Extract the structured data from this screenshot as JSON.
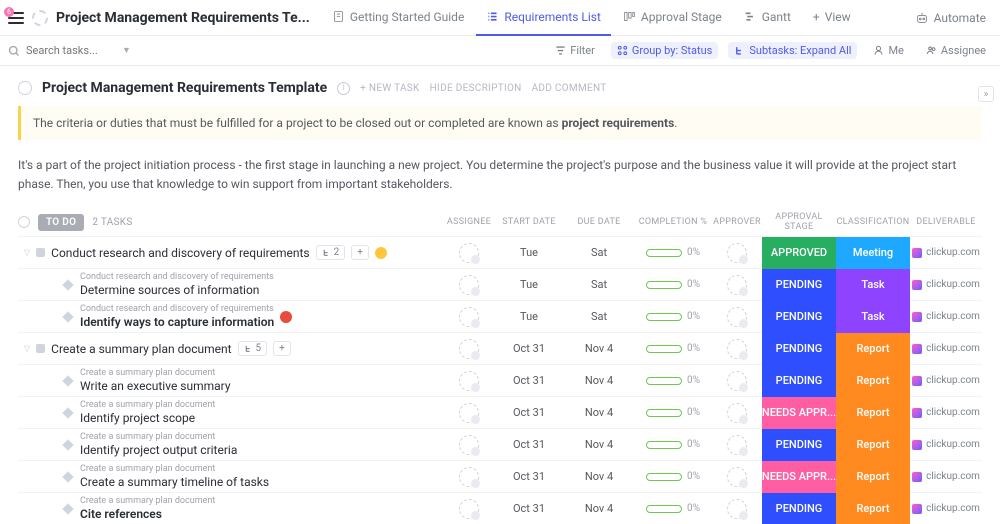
{
  "header": {
    "notif_count": "6",
    "title": "Project Management Requirements Te...",
    "tabs": [
      {
        "label": "Getting Started Guide"
      },
      {
        "label": "Requirements List"
      },
      {
        "label": "Approval Stage"
      },
      {
        "label": "Gantt"
      },
      {
        "label": "View"
      }
    ],
    "automate": "Automate"
  },
  "toolbar": {
    "search_placeholder": "Search tasks...",
    "filter": "Filter",
    "group": "Group by: Status",
    "subtasks": "Subtasks: Expand All",
    "me": "Me",
    "assignee": "Assignee"
  },
  "page": {
    "title": "Project Management Requirements Template",
    "new_task": "+ NEW TASK",
    "hide_desc": "HIDE DESCRIPTION",
    "add_comment": "ADD COMMENT",
    "banner_pre": "The criteria or duties that must be fulfilled for a project to be closed out or completed are known as ",
    "banner_bold": "project requirements",
    "desc": "It's a part of the project initiation process - the first stage in launching a new project. You determine the project's purpose and the business value it will provide at the project start phase. Then, you use that knowledge to win support from important stakeholders."
  },
  "group": {
    "status": "TO DO",
    "count": "2 TASKS"
  },
  "columns": {
    "assignee": "ASSIGNEE",
    "start": "START DATE",
    "due": "DUE DATE",
    "comp": "COMPLETION %",
    "approver": "APPROVER",
    "stage": "APPROVAL STAGE",
    "class": "CLASSIFICATION",
    "deliv": "DELIVERABLE"
  },
  "colors": {
    "approved": "#27ae60",
    "pending": "#2f4fff",
    "needs": "#ff5fa2",
    "meeting": "#1fa8ff",
    "task": "#8e44ff",
    "report": "#ff8a1f"
  },
  "deliv": "clickup.com",
  "tasks": [
    {
      "type": "parent",
      "name": "Conduct research and discovery of requirements",
      "sub_count": "2",
      "flag": "y",
      "start": "Tue",
      "due": "Sat",
      "pct": "0%",
      "stage": "APPROVED",
      "stage_c": "approved",
      "class": "Meeting",
      "class_c": "meeting"
    },
    {
      "type": "sub",
      "crumb": "Conduct research and discovery of requirements",
      "name": "Determine sources of information",
      "start": "Tue",
      "due": "Sat",
      "pct": "0%",
      "stage": "PENDING",
      "stage_c": "pending",
      "class": "Task",
      "class_c": "task"
    },
    {
      "type": "sub",
      "crumb": "Conduct research and discovery of requirements",
      "name": "Identify ways to capture information",
      "flag": "r",
      "start": "Tue",
      "due": "Sat",
      "pct": "0%",
      "stage": "PENDING",
      "stage_c": "pending",
      "class": "Task",
      "class_c": "task",
      "bold": true
    },
    {
      "type": "parent",
      "name": "Create a summary plan document",
      "sub_count": "5",
      "start": "Oct 31",
      "due": "Nov 4",
      "pct": "0%",
      "stage": "PENDING",
      "stage_c": "pending",
      "class": "Report",
      "class_c": "report"
    },
    {
      "type": "sub",
      "crumb": "Create a summary plan document",
      "name": "Write an executive summary",
      "start": "Oct 31",
      "due": "Nov 4",
      "pct": "0%",
      "stage": "PENDING",
      "stage_c": "pending",
      "class": "Report",
      "class_c": "report"
    },
    {
      "type": "sub",
      "crumb": "Create a summary plan document",
      "name": "Identify project scope",
      "start": "Oct 31",
      "due": "Nov 4",
      "pct": "0%",
      "stage": "NEEDS APPR...",
      "stage_c": "needs",
      "class": "Report",
      "class_c": "report"
    },
    {
      "type": "sub",
      "crumb": "Create a summary plan document",
      "name": "Identify project output criteria",
      "start": "Oct 31",
      "due": "Nov 4",
      "pct": "0%",
      "stage": "PENDING",
      "stage_c": "pending",
      "class": "Report",
      "class_c": "report"
    },
    {
      "type": "sub",
      "crumb": "Create a summary plan document",
      "name": "Create a summary timeline of tasks",
      "start": "Oct 31",
      "due": "Nov 4",
      "pct": "0%",
      "stage": "NEEDS APPR...",
      "stage_c": "needs",
      "class": "Report",
      "class_c": "report"
    },
    {
      "type": "sub",
      "crumb": "Create a summary plan document",
      "name": "Cite references",
      "start": "Oct 31",
      "due": "Nov 4",
      "pct": "0%",
      "stage": "PENDING",
      "stage_c": "pending",
      "class": "Report",
      "class_c": "report",
      "bold": true
    }
  ]
}
